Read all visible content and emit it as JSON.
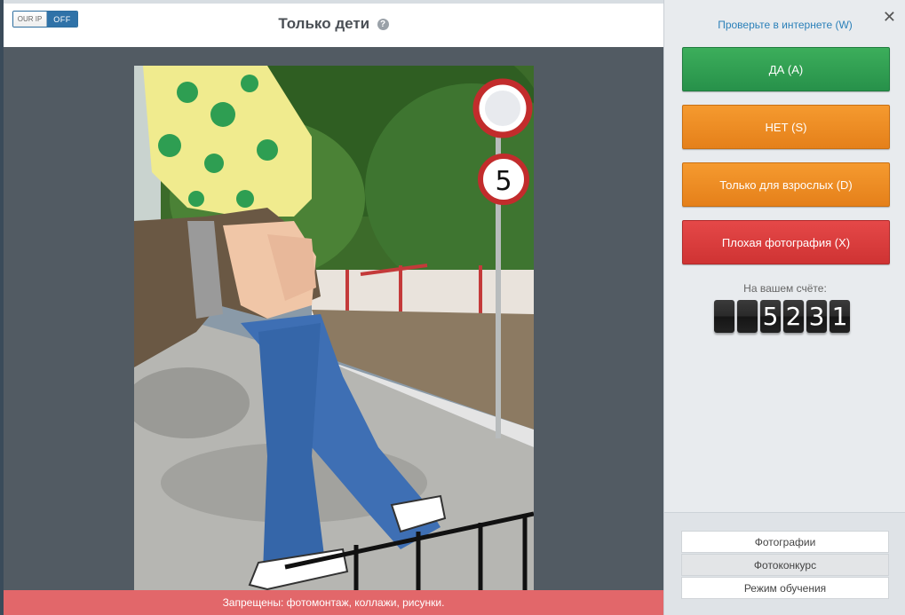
{
  "header": {
    "toggle": {
      "left_label": "OUR IP",
      "right_label": "OFF"
    },
    "title": "Только дети",
    "help_icon": "?"
  },
  "photo": {
    "sign_number": "5"
  },
  "ban_bar": {
    "text": "Запрещены: фотомонтаж, коллажи, рисунки."
  },
  "sidebar": {
    "close_icon": "✕",
    "check_link": "Проверьте в интернете (W)",
    "buttons": {
      "yes": "ДА (A)",
      "no": "НЕТ (S)",
      "adult": "Только для взрослых (D)",
      "bad": "Плохая фотография (X)"
    },
    "balance_label": "На вашем счёте:",
    "balance_digits": [
      "",
      "",
      "5",
      "2",
      "3",
      "1"
    ],
    "modes": [
      "Фотографии",
      "Фотоконкурс",
      "Режим обучения"
    ]
  },
  "colors": {
    "yes": "#2e9e52",
    "no": "#ee8c23",
    "bad": "#d93c3c",
    "ban_bar": "#e2676a",
    "link": "#2b80b9",
    "viewer_bg": "#525b63"
  }
}
